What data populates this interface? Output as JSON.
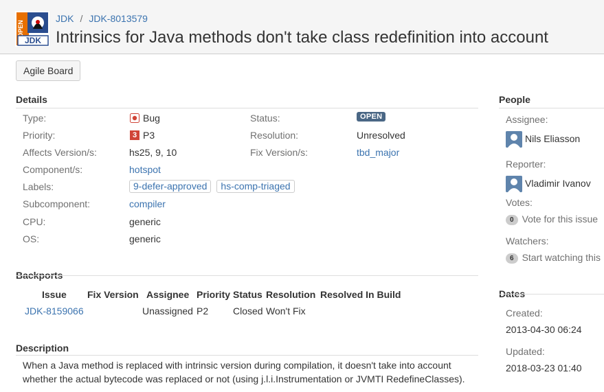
{
  "breadcrumb": {
    "project": "JDK",
    "issue_key": "JDK-8013579"
  },
  "issue_title": "Intrinsics for Java methods don't take class redefinition into account",
  "toolbar": {
    "agile_board_label": "Agile Board"
  },
  "details": {
    "heading": "Details",
    "type_label": "Type:",
    "type_value": "Bug",
    "priority_label": "Priority:",
    "priority_badge": "3",
    "priority_value": "P3",
    "affects_label": "Affects Version/s:",
    "affects_value": "hs25, 9, 10",
    "component_label": "Component/s:",
    "component_value": "hotspot",
    "labels_label": "Labels:",
    "labels": [
      "9-defer-approved",
      "hs-comp-triaged"
    ],
    "subcomponent_label": "Subcomponent:",
    "subcomponent_value": "compiler",
    "cpu_label": "CPU:",
    "cpu_value": "generic",
    "os_label": "OS:",
    "os_value": "generic",
    "status_label": "Status:",
    "status_value": "OPEN",
    "resolution_label": "Resolution:",
    "resolution_value": "Unresolved",
    "fix_label": "Fix Version/s:",
    "fix_value": "tbd_major"
  },
  "backports": {
    "heading": "Backports",
    "columns": [
      "Issue",
      "Fix Version",
      "Assignee",
      "Priority",
      "Status",
      "Resolution",
      "Resolved In Build"
    ],
    "rows": [
      {
        "issue": "JDK-8159066",
        "fix_version": "",
        "assignee": "Unassigned",
        "priority": "P2",
        "status": "Closed",
        "resolution": "Won't Fix",
        "build": ""
      }
    ]
  },
  "description": {
    "heading": "Description",
    "text": "When a Java method is replaced with intrinsic version during compilation, it doesn't take into account whether the actual bytecode was replaced or not (using j.l.i.Instrumentation or JVMTI RedefineClasses)."
  },
  "people": {
    "heading": "People",
    "assignee_label": "Assignee:",
    "assignee_name": "Nils Eliasson",
    "reporter_label": "Reporter:",
    "reporter_name": "Vladimir Ivanov",
    "votes_label": "Votes:",
    "votes_count": "0",
    "vote_link": "Vote for this issue",
    "watchers_label": "Watchers:",
    "watchers_count": "6",
    "watch_link": "Start watching this"
  },
  "dates": {
    "heading": "Dates",
    "created_label": "Created:",
    "created_value": "2013-04-30 06:24",
    "updated_label": "Updated:",
    "updated_value": "2018-03-23 01:40"
  },
  "colors": {
    "link": "#3b73af",
    "status_open": "#4a6785",
    "bug_red": "#d04437"
  },
  "icons": [
    "openjdk-logo",
    "bug-icon",
    "priority-icon",
    "avatar-icon"
  ]
}
